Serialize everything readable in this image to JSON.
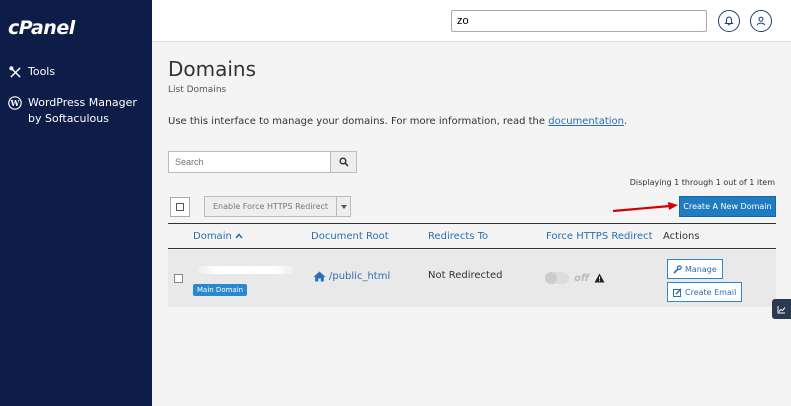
{
  "sidebar": {
    "logo": "cPanel",
    "items": [
      {
        "label": "Tools",
        "icon": "tools-icon"
      },
      {
        "label": "WordPress Manager by Softaculous",
        "icon": "wordpress-icon"
      }
    ]
  },
  "topbar": {
    "search_value": "zo"
  },
  "page": {
    "title": "Domains",
    "subtitle": "List Domains",
    "intro_text": "Use this interface to manage your domains. For more information, read the ",
    "intro_link": "documentation",
    "intro_end": "."
  },
  "toolbar": {
    "search_placeholder": "Search",
    "displaying": "Displaying 1 through 1 out of 1 item",
    "https_button": "Enable Force HTTPS Redirect",
    "create_button": "Create A New Domain"
  },
  "table": {
    "headers": {
      "domain": "Domain",
      "doc_root": "Document Root",
      "redirects": "Redirects To",
      "https": "Force HTTPS Redirect",
      "actions": "Actions"
    },
    "rows": [
      {
        "badge": "Main Domain",
        "doc_root": "/public_html",
        "redirects": "Not Redirected",
        "https_state": "off",
        "manage": "Manage",
        "create_email": "Create Email"
      }
    ]
  },
  "colors": {
    "sidebar_bg": "#0e1d48",
    "primary": "#1f7cc0",
    "link": "#2a6fb3"
  }
}
